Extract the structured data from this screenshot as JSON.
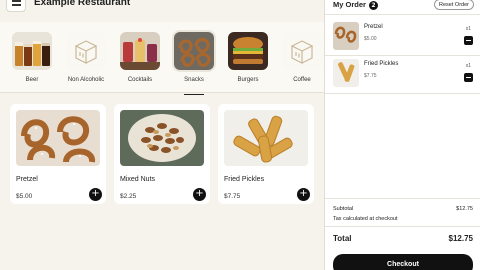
{
  "header": {
    "title": "Example Restaurant"
  },
  "categories": [
    {
      "label": "Beer",
      "icon": "beer-photo"
    },
    {
      "label": "Non Alcoholic",
      "icon": "box-placeholder-icon"
    },
    {
      "label": "Cocktails",
      "icon": "cocktails-photo"
    },
    {
      "label": "Snacks",
      "icon": "snacks-photo",
      "active": true
    },
    {
      "label": "Burgers",
      "icon": "burgers-photo"
    },
    {
      "label": "Coffee",
      "icon": "box-placeholder-icon"
    }
  ],
  "products": [
    {
      "name": "Pretzel",
      "price": "$5.00",
      "add": "+"
    },
    {
      "name": "Mixed Nuts",
      "price": "$2.25",
      "add": "+"
    },
    {
      "name": "Fried Pickles",
      "price": "$7.75",
      "add": "+"
    }
  ],
  "order": {
    "title": "My Order",
    "count": "2",
    "reset_label": "Reset Order",
    "items": [
      {
        "name": "Pretzel",
        "price": "$5.00",
        "qty": "x1"
      },
      {
        "name": "Fried Pickles",
        "price": "$7.75",
        "qty": "x1"
      }
    ],
    "subtotal_label": "Subtotal",
    "subtotal_value": "$12.75",
    "tax_label": "Tax calculated at checkout",
    "total_label": "Total",
    "total_value": "$12.75",
    "checkout_label": "Checkout"
  },
  "colors": {
    "background": "#f5f3ec",
    "accent": "#111111",
    "panel": "#ffffff"
  }
}
